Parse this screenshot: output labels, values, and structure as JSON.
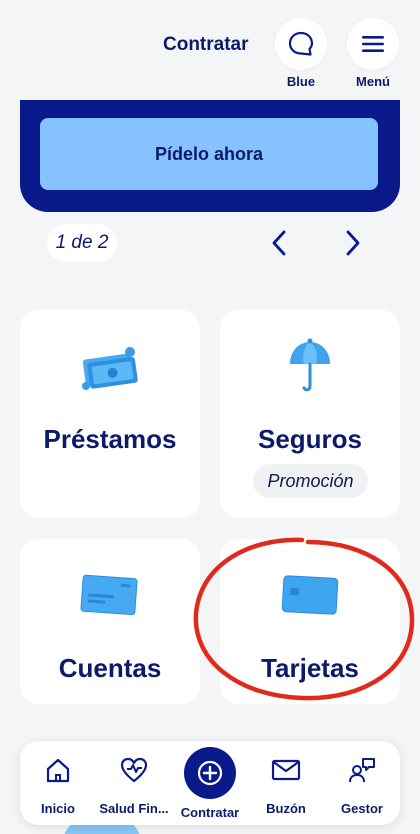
{
  "header": {
    "title": "Contratar",
    "blue_label": "Blue",
    "menu_label": "Menú"
  },
  "banner": {
    "button_label": "Pídelo ahora"
  },
  "pager": {
    "text": "1 de 2"
  },
  "cards": {
    "prestamos": {
      "title": "Préstamos",
      "icon": "money-bills-icon"
    },
    "seguros": {
      "title": "Seguros",
      "badge": "Promoción",
      "icon": "umbrella-icon"
    },
    "cuentas": {
      "title": "Cuentas",
      "icon": "account-card-icon"
    },
    "tarjetas": {
      "title": "Tarjetas",
      "icon": "credit-card-icon"
    }
  },
  "nav": {
    "items": [
      {
        "label": "Inicio",
        "icon": "home-icon"
      },
      {
        "label": "Salud Fin...",
        "icon": "heart-pulse-icon"
      },
      {
        "label": "Contratar",
        "icon": "plus-circle-icon"
      },
      {
        "label": "Buzón",
        "icon": "mail-icon"
      },
      {
        "label": "Gestor",
        "icon": "gestor-chat-icon"
      }
    ]
  },
  "colors": {
    "brand_dark": "#0a1a8a",
    "text_navy": "#0c1a6b",
    "banner_button": "#85c2ff",
    "annotation_red": "#e02a1c",
    "background": "#f4f5f7"
  }
}
